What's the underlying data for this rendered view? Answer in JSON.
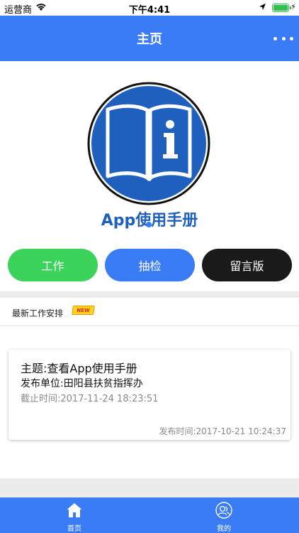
{
  "status_bar": {
    "carrier": "运营商",
    "time": "下午4:41",
    "wifi_icon": "wifi-icon",
    "location_icon": "location-arrow-icon",
    "battery_icon": "battery-icon",
    "charging_icon": "charging-bolt-icon",
    "battery_color": "#2ec24a"
  },
  "nav": {
    "title": "主页",
    "more_icon": "more-dots-icon",
    "color": "#3a7cf6"
  },
  "hero": {
    "logo_icon": "manual-book-info-icon",
    "app_title": "App使用手册",
    "title_color": "#1f5fbe"
  },
  "actions": {
    "work": {
      "label": "工作",
      "color": "#3bd35a"
    },
    "inspect": {
      "label": "抽检",
      "color": "#3a7cf6"
    },
    "board": {
      "label": "留言版",
      "color": "#1a1a1a"
    }
  },
  "section": {
    "label": "最新工作安排",
    "badge": "NEW"
  },
  "task_card": {
    "topic": "主题:查看App使用手册",
    "unit": "发布单位:田阳县扶贫指挥办",
    "deadline": "截止时间:2017-11-24 18:23:51",
    "published": "发布时间:2017-10-21 10:24:37"
  },
  "tabs": [
    {
      "label": "首页",
      "icon": "home-icon"
    },
    {
      "label": "我的",
      "icon": "users-icon"
    }
  ]
}
